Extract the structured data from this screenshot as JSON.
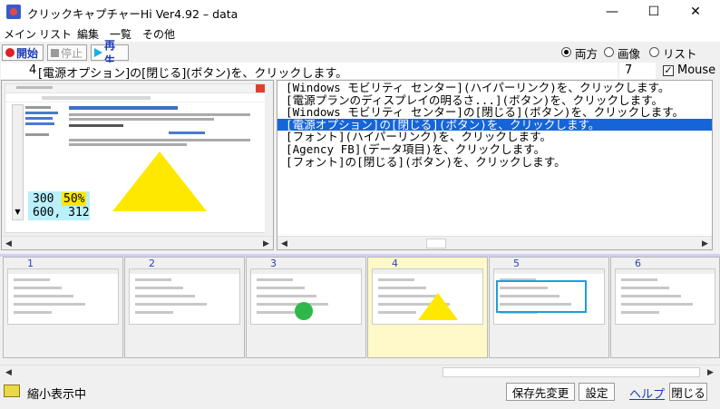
{
  "window": {
    "title": "クリックキャプチャーHi Ver4.92  –  data",
    "minimize": "—",
    "maximize": "☐",
    "close": "✕"
  },
  "menu": [
    "メイン",
    "リスト",
    "編集",
    "一覧",
    "その他"
  ],
  "toolbar": {
    "start": "開始",
    "stop": "停止",
    "play": "再生",
    "radio_both": "両方",
    "radio_image": "画像",
    "radio_list": "リスト",
    "selected_radio": "両方"
  },
  "info": {
    "index": "4",
    "text": "[電源オプション]の[閉じる](ボタン)を、クリックします。",
    "count": "7",
    "mouse_label": "Mouse",
    "mouse_checked": true
  },
  "preview": {
    "zoom": "300",
    "percent": "50%",
    "coords": "600, 312",
    "triangle_color": "#ffe800"
  },
  "log": [
    "[Windows モビリティ センター](ハイパーリンク)を、クリックします。",
    "[電源プランのディスプレイの明るさ...](ボタン)を、クリックします。",
    "[Windows モビリティ センター]の[閉じる](ボタン)を、クリックします。",
    "[電源オプション]の[閉じる](ボタン)を、クリックします。",
    "[フォント](ハイパーリンク)を、クリックします。",
    "[Agency FB](データ項目)を、クリックします。",
    "[フォント]の[閉じる](ボタン)を、クリックします。"
  ],
  "selected_log_index": 3,
  "thumbnails": [
    "1",
    "2",
    "3",
    "4",
    "5",
    "6"
  ],
  "selected_thumbnail": "4",
  "status": {
    "text": "縮小表示中",
    "save_dest": "保存先変更",
    "settings": "設定",
    "help": "ヘルプ",
    "close": "閉じる"
  }
}
